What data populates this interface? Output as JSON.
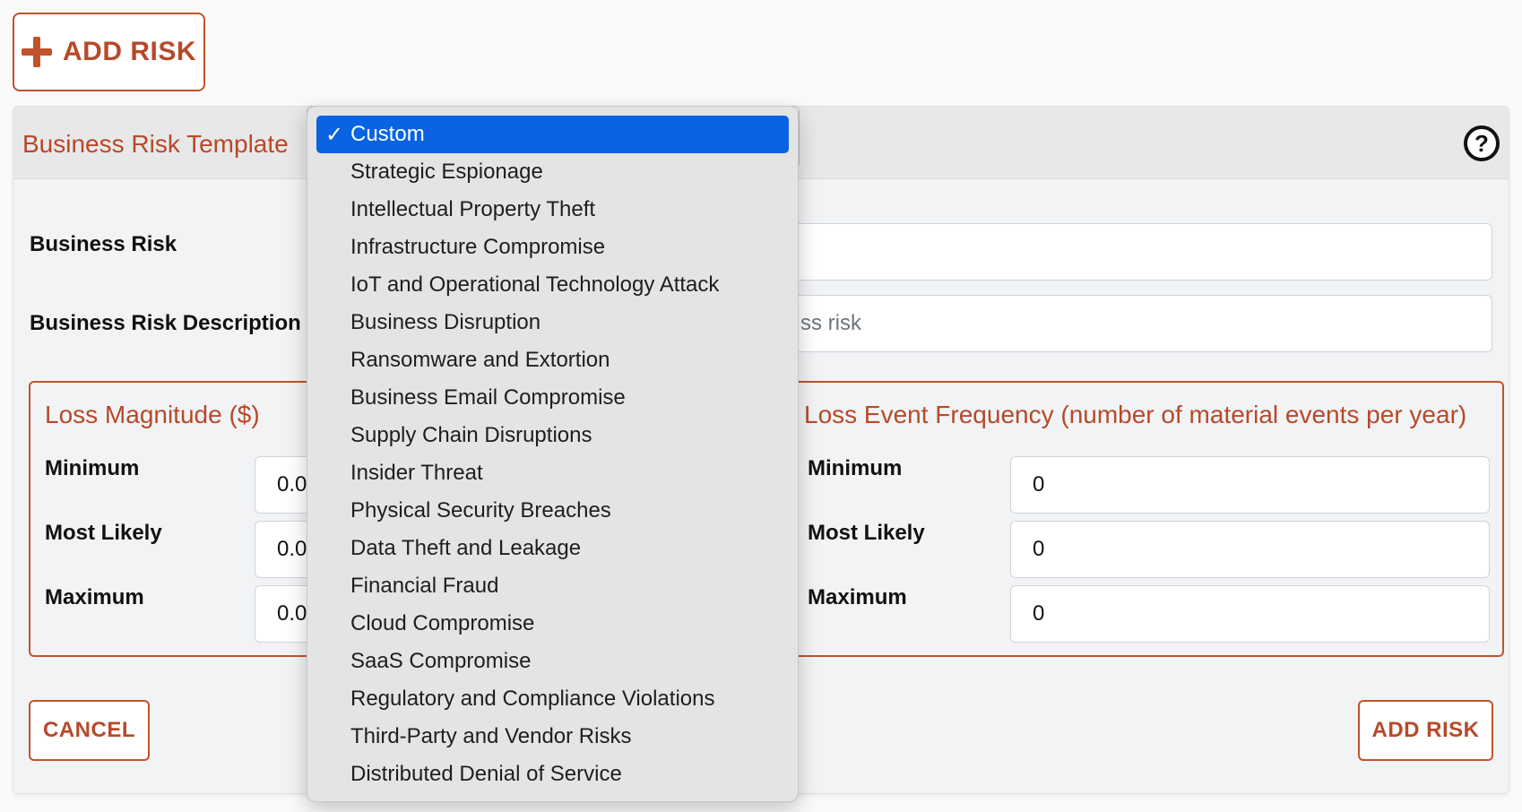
{
  "top_button": {
    "label": "ADD RISK",
    "icon": "plus-icon"
  },
  "panel": {
    "template_label": "Business Risk Template",
    "help_icon": "?"
  },
  "form": {
    "business_risk_label": "Business Risk",
    "business_risk_value": "",
    "description_label": "Business Risk Description",
    "description_placeholder_visible": "ss risk"
  },
  "loss_magnitude": {
    "legend": "Loss Magnitude ($)",
    "min_label": "Minimum",
    "likely_label": "Most Likely",
    "max_label": "Maximum",
    "min_value": "0.0",
    "likely_value": "0.0",
    "max_value": "0.0"
  },
  "loss_frequency": {
    "legend": "Loss Event Frequency (number of material events per year)",
    "min_label": "Minimum",
    "likely_label": "Most Likely",
    "max_label": "Maximum",
    "min_value": "0",
    "likely_value": "0",
    "max_value": "0"
  },
  "actions": {
    "cancel_label": "CANCEL",
    "add_label": "ADD RISK"
  },
  "dropdown": {
    "selected": "Custom",
    "options": [
      "Custom",
      "Strategic Espionage",
      "Intellectual Property Theft",
      "Infrastructure Compromise",
      "IoT and Operational Technology Attack",
      "Business Disruption",
      "Ransomware and Extortion",
      "Business Email Compromise",
      "Supply Chain Disruptions",
      "Insider Threat",
      "Physical Security Breaches",
      "Data Theft and Leakage",
      "Financial Fraud",
      "Cloud Compromise",
      "SaaS Compromise",
      "Regulatory and Compliance Violations",
      "Third-Party and Vendor Risks",
      "Distributed Denial of Service"
    ]
  },
  "colors": {
    "accent": "#b7492a",
    "selected_bg": "#0a63e0",
    "panel_bg": "#f2f3f5"
  }
}
